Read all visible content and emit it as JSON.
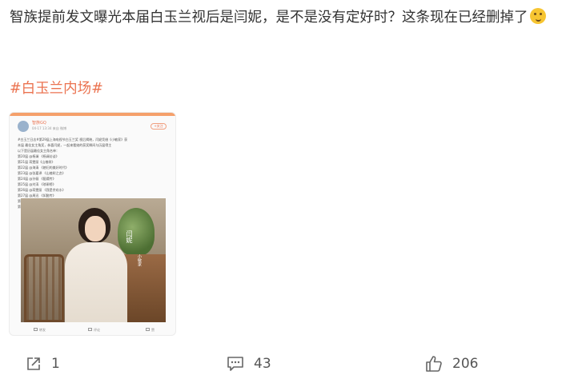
{
  "post": {
    "text": "智族提前发文曝光本届白玉兰视后是闫妮，是不是没有定好时？这条现在已经删掉了",
    "emoji_icon": "thinking-face-emoji",
    "hashtag": "#白玉兰内场#"
  },
  "embedded_image": {
    "name": "智族GQ",
    "meta": "04-17 13:34 来自 微博",
    "follow": "+关注",
    "lines": [
      "#白玉兰日志#第29届上海电视节白玉兰奖 视后揭晓，闫妮凭借《小敏家》获",
      "本届 最佳女主角奖，恭喜闫妮，一起来看她的获奖瞬间与历届得主",
      "以下是历届最佳女主角名单：",
      "第20届 @杨澜 《杨澜访谈》",
      "第21届 蒋雯丽《山楂树》",
      "第22届 @海清 《媳妇的美好时代》",
      "第23届 @张嘉译 《山楂树之恋》",
      "第24届 @孙俪 《甄嬛传》",
      "第25届 @刘涛 《琅琊榜》",
      "第26届 @蒋雯丽 《我是余欢水》",
      "第27届 @周迅 《如懿传》",
      "第28届 @马伊琍 《我的前半生》",
      "第29届 闫妮 《小敏家》"
    ],
    "photo_caption_main": "闫妮",
    "photo_caption_sub": "小敏家",
    "actions": {
      "share": "转发",
      "comment": "评论",
      "like": "赞"
    }
  },
  "actions": {
    "share_count": "1",
    "comment_count": "43",
    "like_count": "206"
  },
  "colors": {
    "hashtag": "#eb7350",
    "text": "#333333",
    "icon": "#666666"
  }
}
